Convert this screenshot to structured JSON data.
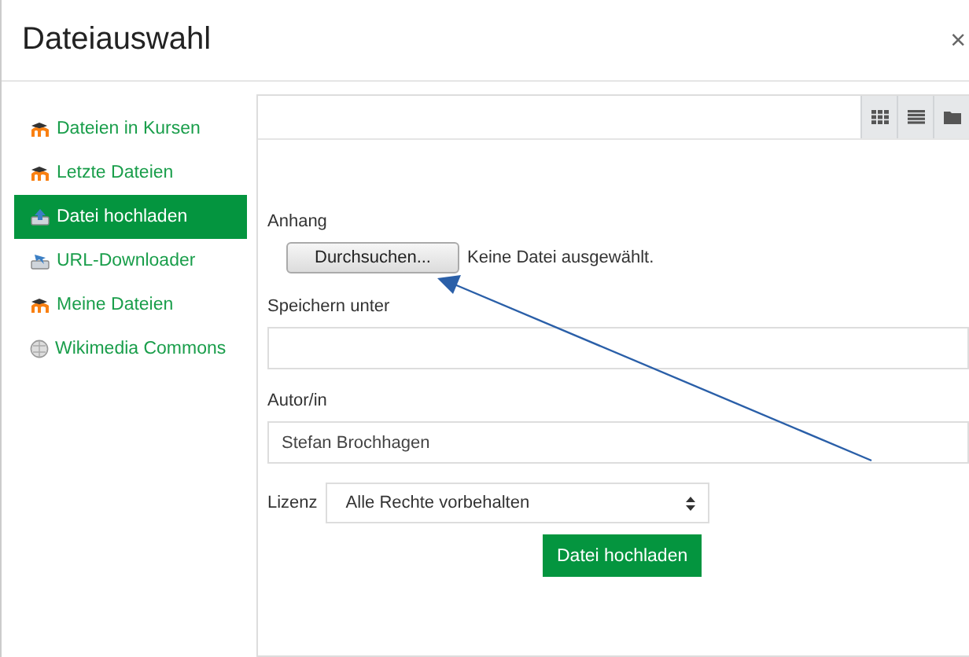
{
  "window": {
    "title": "Dateiauswahl",
    "close": "×"
  },
  "sidebar": {
    "items": [
      {
        "label": "Dateien in Kursen",
        "kind": "moodle",
        "selected": false
      },
      {
        "label": "Letzte Dateien",
        "kind": "moodle",
        "selected": false
      },
      {
        "label": "Datei hochladen",
        "kind": "upload",
        "selected": true
      },
      {
        "label": "URL-Downloader",
        "kind": "download",
        "selected": false
      },
      {
        "label": "Meine Dateien",
        "kind": "moodle",
        "selected": false
      },
      {
        "label": "Wikimedia Commons",
        "kind": "globe",
        "selected": false
      }
    ]
  },
  "toolbar": {
    "views": [
      {
        "kind": "grid"
      },
      {
        "kind": "list"
      },
      {
        "kind": "folder"
      }
    ]
  },
  "form": {
    "attachment_label": "Anhang",
    "browse_button": "Durchsuchen...",
    "no_file": "Keine Datei ausgewählt.",
    "save_as_label": "Speichern unter",
    "author_label": "Autor/in",
    "author_value": "Stefan Brochhagen",
    "license_label": "Lizenz",
    "license_value": "Alle Rechte vorbehalten",
    "submit": "Datei hochladen"
  }
}
